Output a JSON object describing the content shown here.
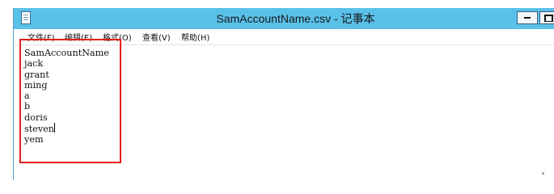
{
  "window": {
    "title": "SamAccountName.csv - 记事本",
    "icon": "notepad-icon",
    "buttons": {
      "minimize": "minimize-icon",
      "maximize": "maximize-icon"
    }
  },
  "menu": {
    "items": [
      {
        "label": "文件(F)"
      },
      {
        "label": "编辑(E)"
      },
      {
        "label": "格式(O)"
      },
      {
        "label": "查看(V)"
      },
      {
        "label": "帮助(H)"
      }
    ]
  },
  "editor": {
    "lines": [
      "SamAccountName",
      "jack",
      "grant",
      "ming",
      "a",
      "b",
      "doris",
      "steven",
      "yem"
    ],
    "caret_line": 8
  },
  "colors": {
    "titlebar": "#59c0e8",
    "highlight": "#e51f1f"
  }
}
